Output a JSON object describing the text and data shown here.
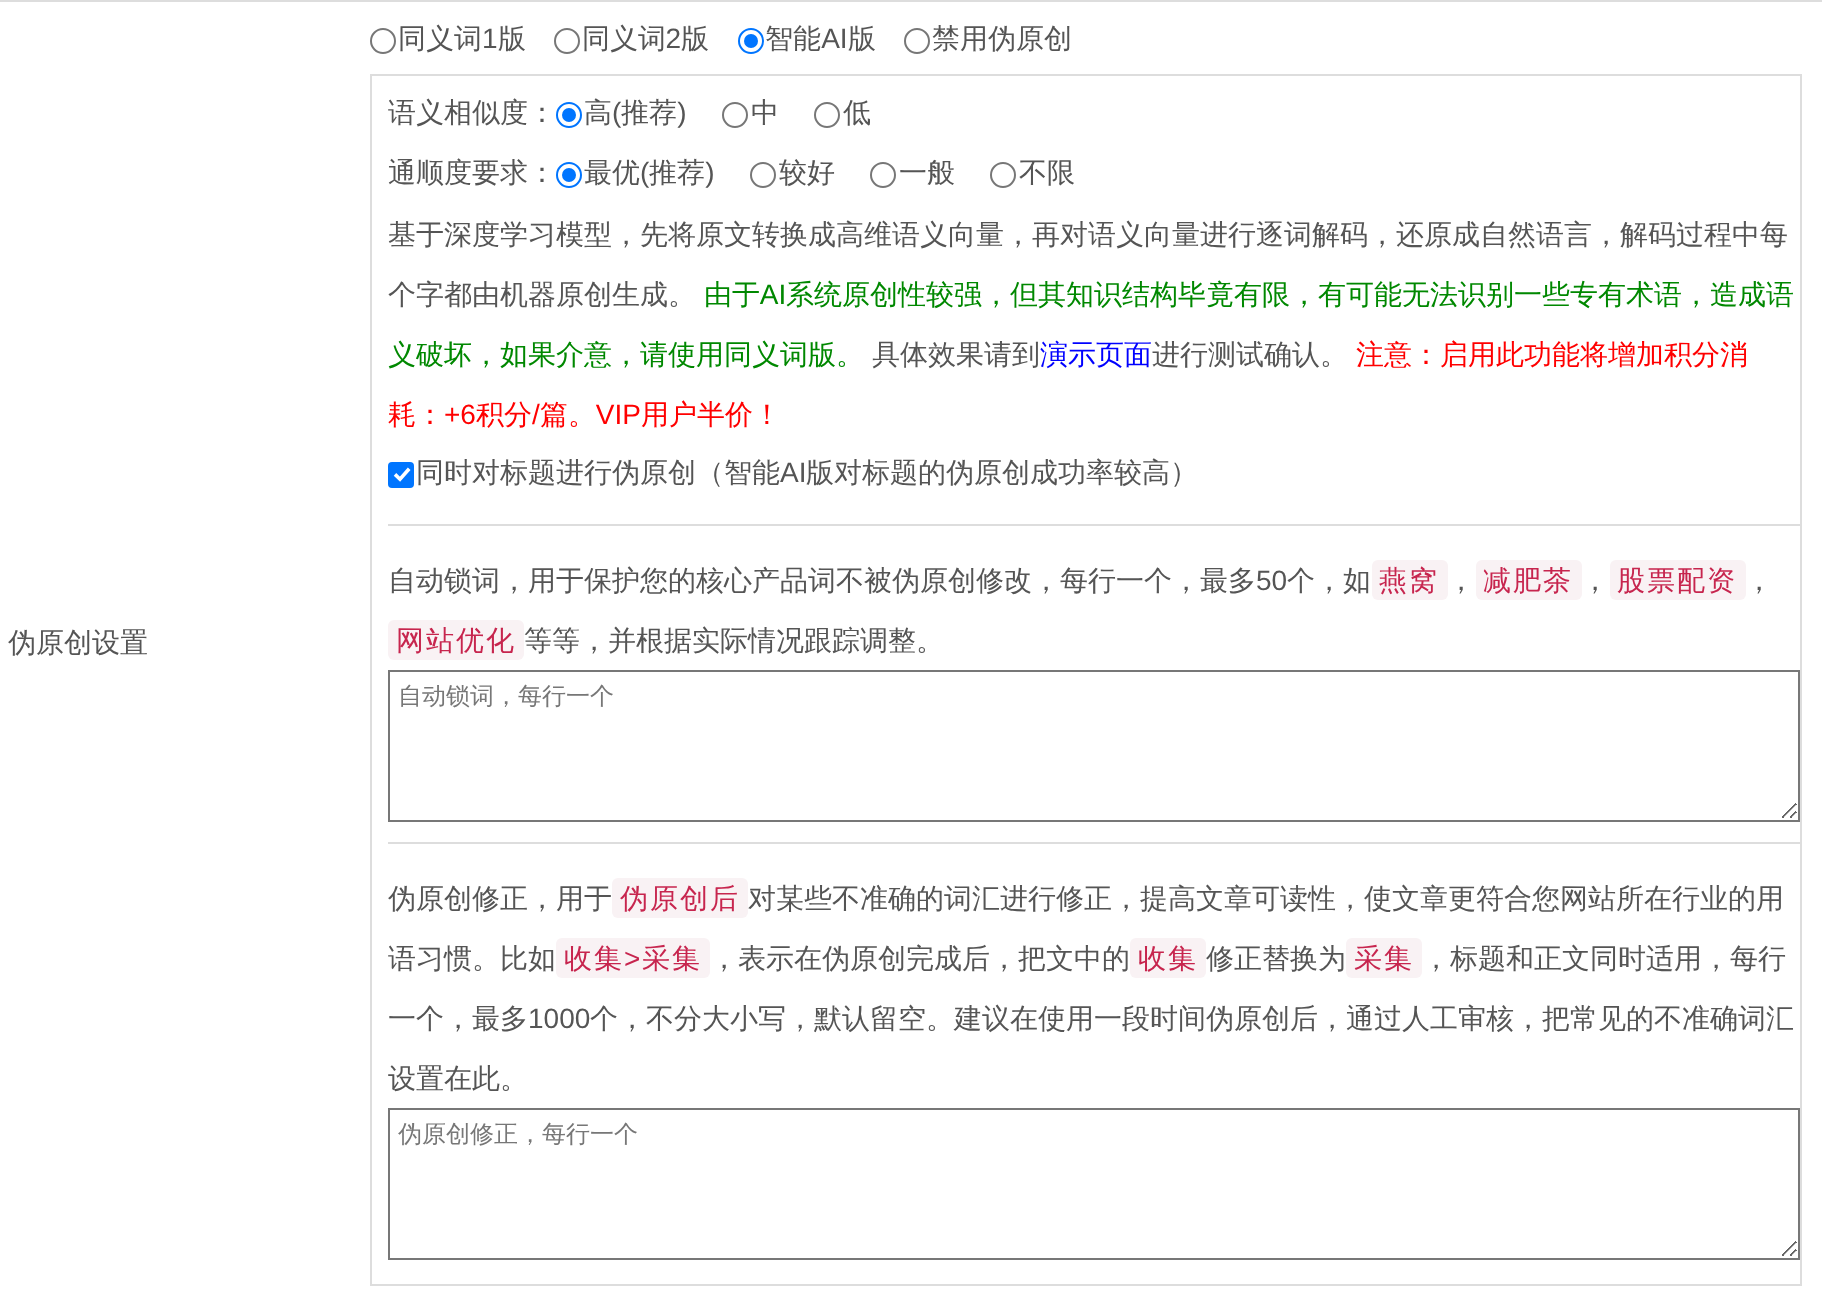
{
  "label": "伪原创设置",
  "modes": [
    {
      "label": "同义词1版",
      "selected": false
    },
    {
      "label": "同义词2版",
      "selected": false
    },
    {
      "label": "智能AI版",
      "selected": true
    },
    {
      "label": "禁用伪原创",
      "selected": false
    }
  ],
  "similarity": {
    "label": "语义相似度：",
    "options": [
      {
        "label": "高(推荐)",
        "selected": true
      },
      {
        "label": "中",
        "selected": false
      },
      {
        "label": "低",
        "selected": false
      }
    ]
  },
  "fluency": {
    "label": "通顺度要求：",
    "options": [
      {
        "label": "最优(推荐)",
        "selected": true
      },
      {
        "label": "较好",
        "selected": false
      },
      {
        "label": "一般",
        "selected": false
      },
      {
        "label": "不限",
        "selected": false
      }
    ]
  },
  "description": [
    {
      "kind": "plain",
      "text": "基于深度学习模型，先将原文转换成高维语义向量，再对语义向量进行逐词解码，还原成自然语言，解码过程中每个字都由机器原创生成。 "
    },
    {
      "kind": "green",
      "text": "由于AI系统原创性较强，但其知识结构毕竟有限，有可能无法识别一些专有术语，造成语义破坏，如果介意，请使用同义词版。"
    },
    {
      "kind": "plain",
      "text": " 具体效果请到"
    },
    {
      "kind": "link",
      "text": "演示页面"
    },
    {
      "kind": "plain",
      "text": "进行测试确认。 "
    },
    {
      "kind": "red",
      "text": "注意：启用此功能将增加积分消耗：+6积分/篇。VIP用户半价！"
    }
  ],
  "title_option": {
    "label": "同时对标题进行伪原创（智能AI版对标题的伪原创成功率较高）",
    "checked": true
  },
  "lock_words": {
    "text": [
      {
        "kind": "plain",
        "text": "自动锁词，用于保护您的核心产品词不被伪原创修改，每行一个，最多50个，如"
      },
      {
        "kind": "code",
        "text": "燕窝"
      },
      {
        "kind": "plain",
        "text": "，"
      },
      {
        "kind": "code",
        "text": "减肥茶"
      },
      {
        "kind": "plain",
        "text": "，"
      },
      {
        "kind": "code",
        "text": "股票配资"
      },
      {
        "kind": "plain",
        "text": "，"
      },
      {
        "kind": "code",
        "text": "网站优化"
      },
      {
        "kind": "plain",
        "text": "等等，并根据实际情况跟踪调整。"
      }
    ],
    "placeholder": "自动锁词，每行一个"
  },
  "corrections": {
    "text": [
      {
        "kind": "plain",
        "text": "伪原创修正，用于"
      },
      {
        "kind": "code",
        "text": "伪原创后"
      },
      {
        "kind": "plain",
        "text": "对某些不准确的词汇进行修正，提高文章可读性，使文章更符合您网站所在行业的用语习惯。比如"
      },
      {
        "kind": "code",
        "text": "收集>采集"
      },
      {
        "kind": "plain",
        "text": "，表示在伪原创完成后，把文中的"
      },
      {
        "kind": "code",
        "text": "收集"
      },
      {
        "kind": "plain",
        "text": "修正替换为"
      },
      {
        "kind": "code",
        "text": "采集"
      },
      {
        "kind": "plain",
        "text": "，标题和正文同时适用，每行一个，最多1000个，不分大小写，默认留空。建议在使用一段时间伪原创后，通过人工审核，把常见的不准确词汇设置在此。"
      }
    ],
    "placeholder": "伪原创修正，每行一个"
  }
}
